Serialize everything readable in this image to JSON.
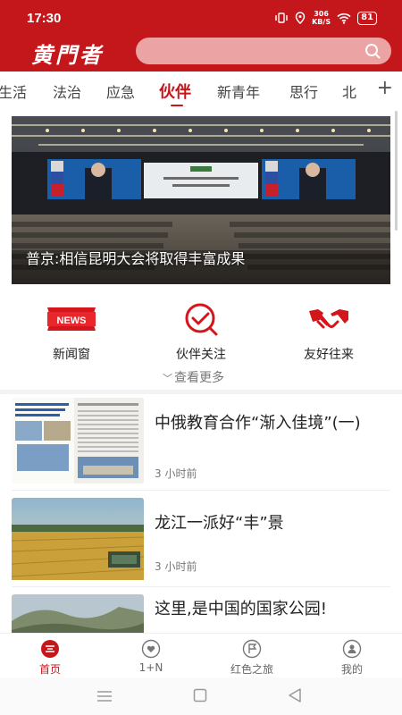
{
  "status": {
    "time": "17:30",
    "speed_value": "306",
    "speed_unit": "KB/S",
    "battery": "81"
  },
  "header": {
    "logo": "黄門者",
    "search_placeholder": ""
  },
  "tabs": [
    {
      "label": "生活"
    },
    {
      "label": "法治"
    },
    {
      "label": "应急"
    },
    {
      "label": "伙伴",
      "active": true
    },
    {
      "label": "新青年"
    },
    {
      "label": "思行"
    },
    {
      "label": "北"
    }
  ],
  "tab_add": "+",
  "hero": {
    "caption": "普京:相信昆明大会将取得丰富成果"
  },
  "quick_links": [
    {
      "label": "新闻窗",
      "icon": "news-badge-icon",
      "badge_text": "NEWS"
    },
    {
      "label": "伙伴关注",
      "icon": "check-bubble-icon"
    },
    {
      "label": "友好往来",
      "icon": "handshake-icon"
    }
  ],
  "more": {
    "label": "查看更多"
  },
  "news": [
    {
      "title": "中俄教育合作“渐入佳境”(一)",
      "time": "3 小时前"
    },
    {
      "title": "龙江一派好“丰”景",
      "time": "3 小时前"
    },
    {
      "title": "这里,是中国的国家公园!",
      "time": ""
    }
  ],
  "bottom_nav": [
    {
      "label": "首页",
      "active": true
    },
    {
      "label": "1+N"
    },
    {
      "label": "红色之旅"
    },
    {
      "label": "我的"
    }
  ],
  "colors": {
    "brand": "#c4171c",
    "search_bg": "#eba3a4"
  }
}
